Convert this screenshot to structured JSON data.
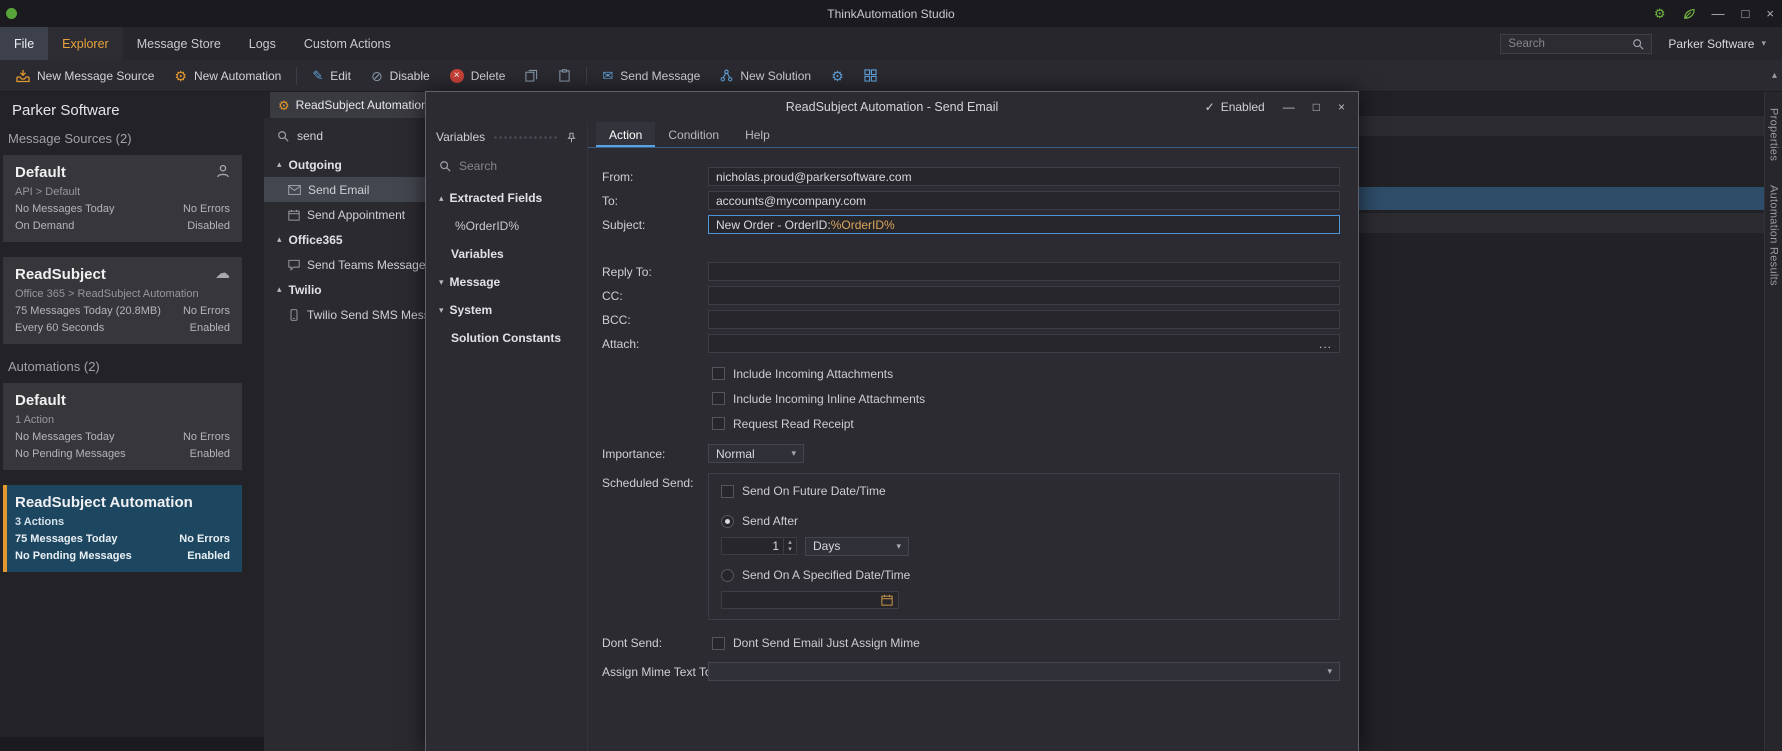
{
  "colors": {
    "accent_orange": "#e2982f",
    "accent_blue": "#57a1e4",
    "selection_blue": "#1d4760",
    "delete_red": "#ca4339"
  },
  "icons": {
    "caret_up": "▴",
    "caret_down": "▾",
    "check": "✓",
    "minimize": "—",
    "maximize": "□",
    "close": "×",
    "gear": "⚙",
    "pencil": "✎",
    "disable": "⊘",
    "delete_x": "×",
    "envelope": "✉",
    "cloud": "☁",
    "ellipsis": "..."
  },
  "titlebar": {
    "title": "ThinkAutomation Studio"
  },
  "menubar": {
    "items": [
      "File",
      "Explorer",
      "Message Store",
      "Logs",
      "Custom Actions"
    ],
    "search_placeholder": "Search",
    "account": "Parker Software"
  },
  "toolbar": {
    "new_message_source": "New Message Source",
    "new_automation": "New Automation",
    "edit": "Edit",
    "disable": "Disable",
    "delete": "Delete",
    "send_message": "Send Message",
    "new_solution": "New Solution"
  },
  "sidebar": {
    "title": "Parker Software",
    "sections": [
      {
        "heading": "Message Sources (2)",
        "cards": [
          {
            "title": "Default",
            "subtitle": "API > Default",
            "rows": [
              {
                "left": "No Messages Today",
                "right": "No Errors"
              },
              {
                "left": "On Demand",
                "right": "Disabled"
              }
            ]
          },
          {
            "title": "ReadSubject",
            "subtitle": "Office 365 > ReadSubject Automation",
            "rows": [
              {
                "left": "75 Messages Today (20.8MB)",
                "right": "No Errors"
              },
              {
                "left": "Every 60 Seconds",
                "right": "Enabled"
              }
            ]
          }
        ]
      },
      {
        "heading": "Automations (2)",
        "cards": [
          {
            "title": "Default",
            "subtitle": "1 Action",
            "rows": [
              {
                "left": "No Messages Today",
                "right": "No Errors"
              },
              {
                "left": "No Pending Messages",
                "right": "Enabled"
              }
            ]
          },
          {
            "title": "ReadSubject Automation",
            "subtitle": "3 Actions",
            "rows": [
              {
                "left": "75 Messages Today",
                "right": "No Errors"
              },
              {
                "left": "No Pending Messages",
                "right": "Enabled"
              }
            ]
          }
        ]
      }
    ]
  },
  "automation_panel": {
    "tab_label": "ReadSubject Automation*",
    "search_value": "send",
    "tree": [
      {
        "label": "Outgoing",
        "items": [
          {
            "label": "Send Email",
            "selected": true
          },
          {
            "label": "Send Appointment"
          }
        ]
      },
      {
        "label": "Office365",
        "items": [
          {
            "label": "Send Teams Message"
          }
        ]
      },
      {
        "label": "Twilio",
        "items": [
          {
            "label": "Twilio Send SMS Messag"
          }
        ]
      }
    ]
  },
  "dialog": {
    "title": "ReadSubject Automation - Send Email",
    "enabled_label": "Enabled",
    "variables_panel": {
      "header": "Variables",
      "search_placeholder": "Search",
      "tree": [
        {
          "label": "Extracted Fields",
          "state": "expanded",
          "children": [
            {
              "label": "%OrderID%"
            }
          ]
        },
        {
          "label": "Variables"
        },
        {
          "label": "Message",
          "state": "collapsed"
        },
        {
          "label": "System",
          "state": "collapsed"
        },
        {
          "label": "Solution Constants"
        }
      ]
    },
    "tabs": [
      "Action",
      "Condition",
      "Help"
    ],
    "form": {
      "from_label": "From:",
      "from_value": "nicholas.proud@parkersoftware.com",
      "to_label": "To:",
      "to_value": "accounts@mycompany.com",
      "subject_label": "Subject:",
      "subject_prefix": "New Order - OrderID: ",
      "subject_variable": "%OrderID%",
      "reply_to_label": "Reply To:",
      "cc_label": "CC:",
      "bcc_label": "BCC:",
      "attach_label": "Attach:",
      "checkbox_incoming": "Include Incoming Attachments",
      "checkbox_inline": "Include Incoming Inline Attachments",
      "checkbox_receipt": "Request Read Receipt",
      "importance_label": "Importance:",
      "importance_value": "Normal",
      "scheduled_label": "Scheduled Send:",
      "future_checkbox": "Send On Future Date/Time",
      "send_after_radio": "Send After",
      "send_after_value": "1",
      "send_after_unit": "Days",
      "specified_radio": "Send On A Specified Date/Time",
      "dont_send_label": "Dont Send:",
      "dont_send_checkbox": "Dont Send Email Just Assign Mime",
      "assign_mime_label": "Assign Mime Text To:"
    }
  },
  "right_rail": {
    "tabs": [
      {
        "label": "Properties"
      },
      {
        "label": "Automation Results"
      }
    ]
  }
}
